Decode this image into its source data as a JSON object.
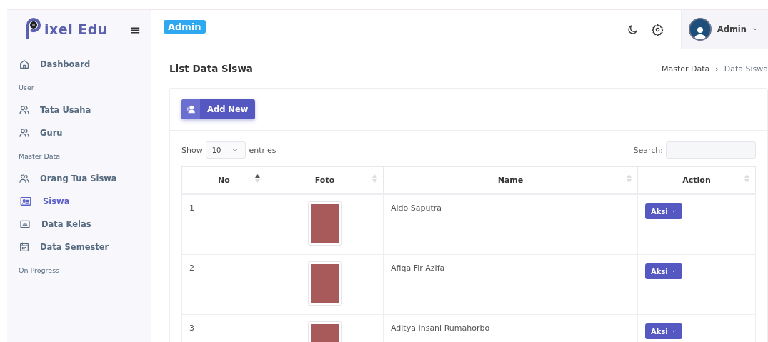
{
  "brand": {
    "logo": "ixel Edu",
    "menu_icon": "≡"
  },
  "header": {
    "role_badge": "Admin",
    "user": {
      "name": "Admin"
    }
  },
  "sidebar": {
    "items": [
      {
        "kind": "item",
        "label": "Dashboard",
        "selected": false
      },
      {
        "kind": "heading",
        "label": "User"
      },
      {
        "kind": "item",
        "label": "Tata Usaha",
        "selected": false
      },
      {
        "kind": "item",
        "label": "Guru",
        "selected": false
      },
      {
        "kind": "heading",
        "label": "Master Data"
      },
      {
        "kind": "item",
        "label": "Orang Tua Siswa",
        "selected": false
      },
      {
        "kind": "item",
        "label": "Siswa",
        "selected": true
      },
      {
        "kind": "item",
        "label": "Data Kelas",
        "selected": false
      },
      {
        "kind": "item",
        "label": "Data Semester",
        "selected": false
      },
      {
        "kind": "heading",
        "label": "On Progress"
      }
    ]
  },
  "page": {
    "title": "List Data Siswa",
    "breadcrumb": [
      {
        "label": "Master Data",
        "current": false
      },
      {
        "label": "Data Siswa",
        "current": true
      }
    ],
    "breadcrumb_separator": "›"
  },
  "toolbar": {
    "add_button": "Add New"
  },
  "table_controls": {
    "show_label": "Show",
    "page_size": "10",
    "entries_label": "entries",
    "search_label": "Search:"
  },
  "table": {
    "columns": [
      {
        "label": "No",
        "sorted": true
      },
      {
        "label": "Foto",
        "sorted": false
      },
      {
        "label": "Name",
        "sorted": false
      },
      {
        "label": "Action",
        "sorted": false
      }
    ],
    "rows": [
      {
        "no": "1",
        "name": "Aldo Saputra",
        "action": "Aksi"
      },
      {
        "no": "2",
        "name": "Afiqa Fir Azifa",
        "action": "Aksi"
      },
      {
        "no": "3",
        "name": "Aditya Insani Rumahorbo",
        "action": "Aksi"
      }
    ]
  }
}
